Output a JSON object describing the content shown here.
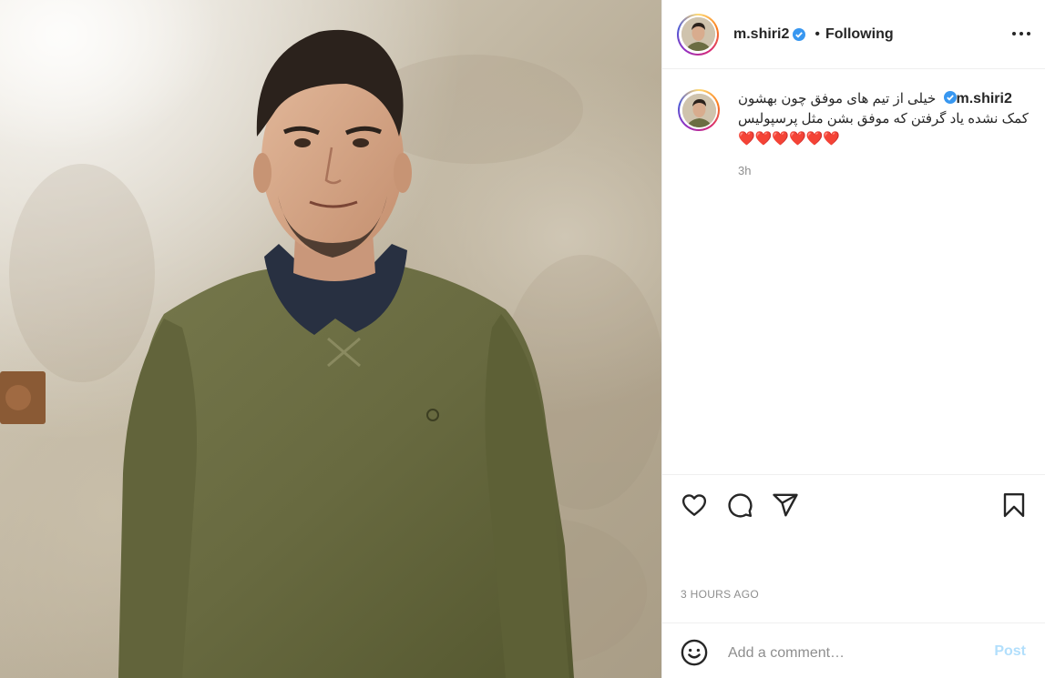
{
  "post": {
    "image_alt": "man in olive green sweater with dark collar",
    "header": {
      "username": "m.shiri2",
      "separator": "•",
      "follow_status": "Following",
      "verified": true
    },
    "caption": {
      "username": "m.shiri2",
      "text": "خیلی از تیم های موفق چون بهشون کمک نشده یاد گرفتن که موفق بشن مثل پرسپولیس❤️❤️❤️❤️❤️❤️",
      "time_ago": "3h"
    },
    "actions": {
      "like_icon": "heart-icon",
      "comment_icon": "comment-icon",
      "share_icon": "paper-plane-icon",
      "save_icon": "bookmark-icon"
    },
    "posted_time": "3 HOURS AGO",
    "comment_box": {
      "placeholder": "Add a comment…",
      "post_label": "Post",
      "emoji_icon": "emoji-icon"
    }
  },
  "colors": {
    "verified": "#3897f0",
    "post_button_disabled": "#b2dffc",
    "secondary_text": "#8e8e8e",
    "border": "#efefef"
  }
}
